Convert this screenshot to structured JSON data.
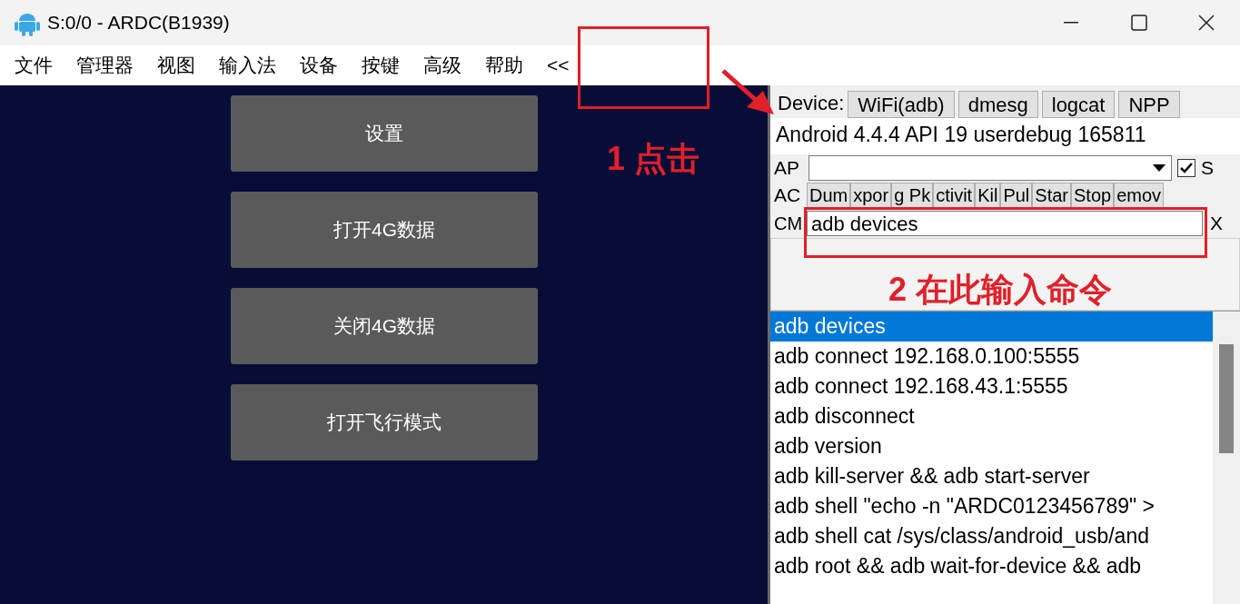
{
  "window": {
    "title": "S:0/0 - ARDC(B1939)"
  },
  "menu": [
    "文件",
    "管理器",
    "视图",
    "输入法",
    "设备",
    "按键",
    "高级",
    "帮助",
    "<<"
  ],
  "phone_buttons": [
    "设置",
    "打开4G数据",
    "关闭4G数据",
    "打开飞行模式"
  ],
  "device_bar": {
    "label": "Device:",
    "tabs": [
      "WiFi(adb)",
      "dmesg",
      "logcat",
      "NPP"
    ]
  },
  "device_info": "Android 4.4.4 API 19 userdebug 165811",
  "api_row": {
    "label": "AP",
    "sync": {
      "label": "S",
      "checked": true
    }
  },
  "action_row": {
    "label": "AC",
    "buttons": [
      "Dum",
      "xpor",
      "g Pk",
      "ctivit",
      "Kil",
      "Pul",
      "Star",
      "Stop",
      "emov"
    ]
  },
  "cmd_row": {
    "label": "CM",
    "value": "adb devices",
    "clear": "X"
  },
  "history": [
    {
      "text": "adb devices",
      "selected": true
    },
    {
      "text": "adb connect 192.168.0.100:5555",
      "selected": false
    },
    {
      "text": "adb connect 192.168.43.1:5555",
      "selected": false
    },
    {
      "text": "adb disconnect",
      "selected": false
    },
    {
      "text": "adb version",
      "selected": false
    },
    {
      "text": "adb kill-server && adb start-server",
      "selected": false
    },
    {
      "text": "adb shell \"echo -n \"ARDC0123456789\" >",
      "selected": false
    },
    {
      "text": "adb shell cat /sys/class/android_usb/and",
      "selected": false
    },
    {
      "text": "adb root && adb wait-for-device && adb",
      "selected": false
    }
  ],
  "annotations": [
    "1 点击",
    "2 在此输入命令"
  ]
}
